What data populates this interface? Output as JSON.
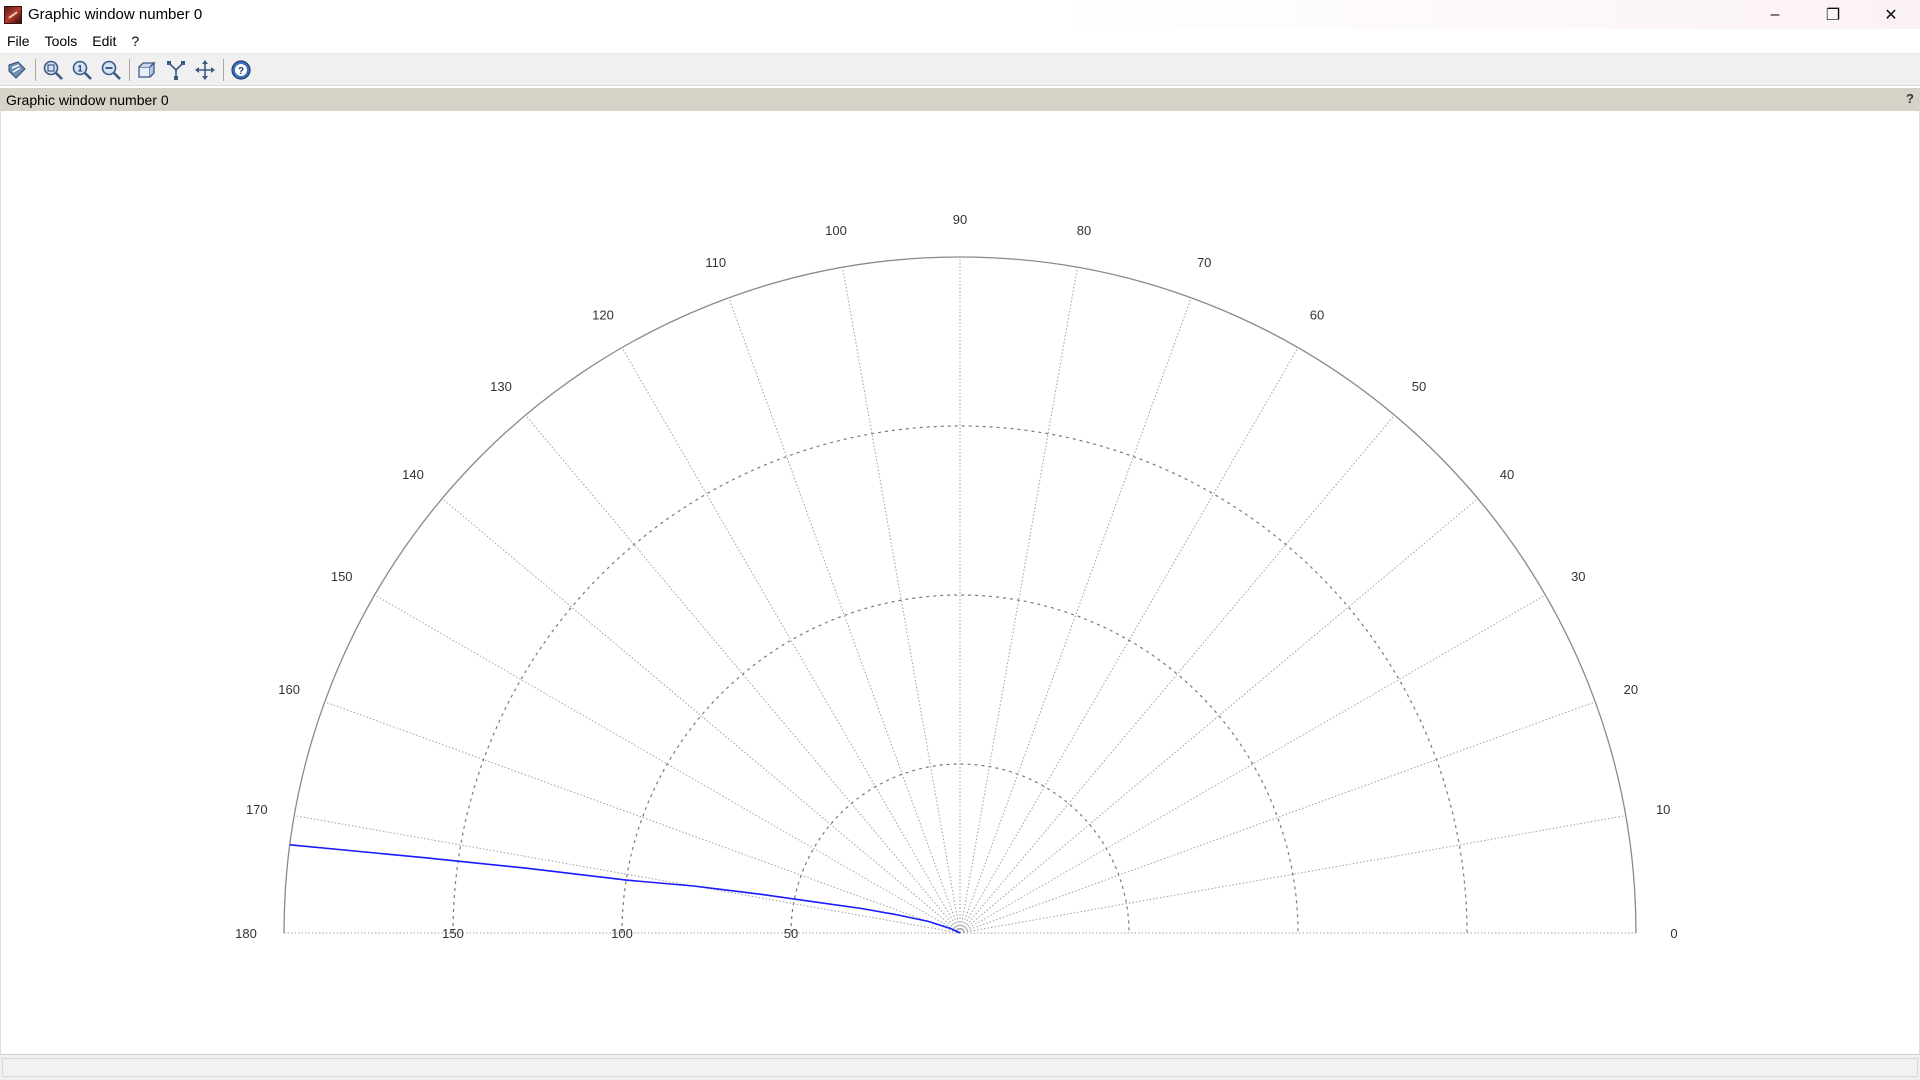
{
  "window": {
    "title": "Graphic window number 0",
    "controls": {
      "minimize": "–",
      "restore": "❐",
      "close": "✕"
    }
  },
  "menu": {
    "items": [
      "File",
      "Tools",
      "Edit",
      "?"
    ]
  },
  "toolbar": {
    "buttons": [
      {
        "icon": "datatip-icon"
      },
      {
        "icon": "zoom-icon"
      },
      {
        "icon": "zoom-original-icon"
      },
      {
        "icon": "zoom-out-icon"
      },
      {
        "icon": "rotate-3d-icon"
      },
      {
        "icon": "curve-icon"
      },
      {
        "icon": "pan-icon"
      },
      {
        "icon": "help-icon"
      }
    ]
  },
  "panel": {
    "label": "Graphic window number 0",
    "help": "?"
  },
  "colors": {
    "curve": "#1a1aff",
    "grid": "#a0a0a0",
    "frame": "#8a8a8a"
  },
  "chart_data": {
    "type": "line",
    "coordinate_system": "polar",
    "angular_range_deg": [
      0,
      180
    ],
    "radial_max": 200,
    "angle_ticks": [
      0,
      10,
      20,
      30,
      40,
      50,
      60,
      70,
      80,
      90,
      100,
      110,
      120,
      130,
      140,
      150,
      160,
      170,
      180
    ],
    "radial_rings": [
      50,
      100,
      150
    ],
    "radial_tick_labels": [
      "150",
      "100",
      "50"
    ],
    "angle_tick_labels": [
      "0",
      "10",
      "20",
      "30",
      "40",
      "50",
      "60",
      "70",
      "80",
      "90",
      "100",
      "110",
      "120",
      "130",
      "140",
      "150",
      "160",
      "170",
      "180"
    ],
    "series": [
      {
        "points": [
          {
            "theta": 154,
            "r": 3
          },
          {
            "theta": 160,
            "r": 10
          },
          {
            "theta": 164,
            "r": 20
          },
          {
            "theta": 166,
            "r": 30
          },
          {
            "theta": 168,
            "r": 45
          },
          {
            "theta": 169,
            "r": 60
          },
          {
            "theta": 170,
            "r": 80
          },
          {
            "theta": 171,
            "r": 100
          },
          {
            "theta": 171.5,
            "r": 130
          },
          {
            "theta": 172,
            "r": 160
          },
          {
            "theta": 172.5,
            "r": 200
          }
        ]
      }
    ],
    "grid": true
  }
}
